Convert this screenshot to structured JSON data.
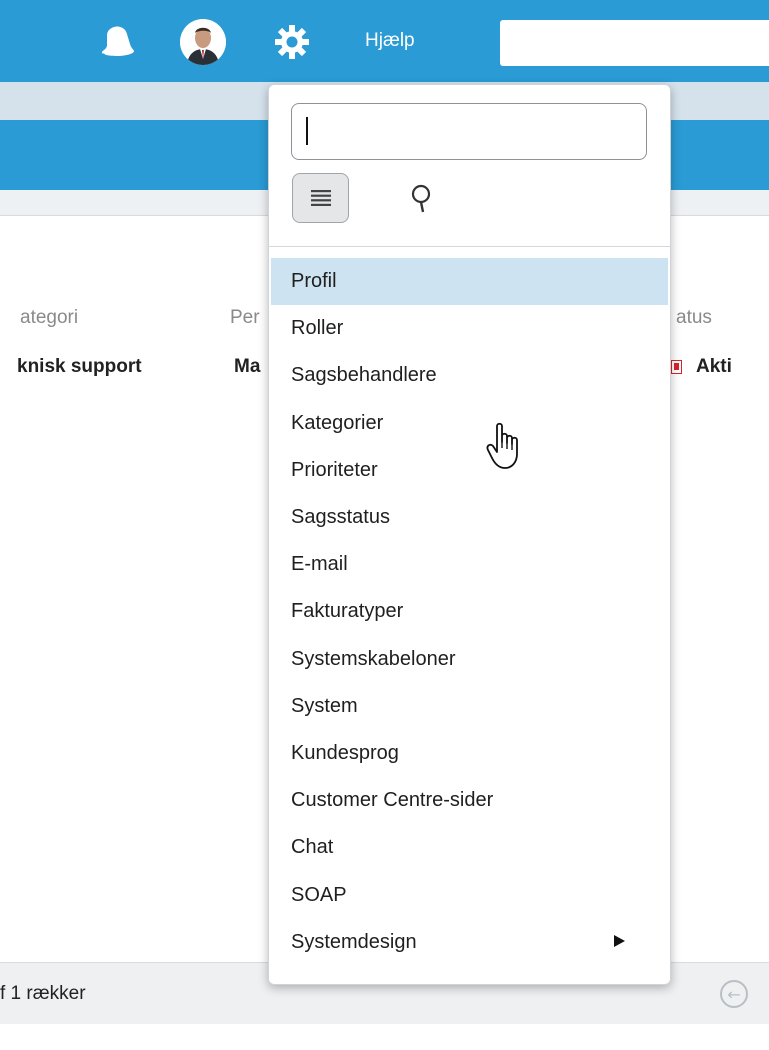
{
  "topbar": {
    "help_label": "Hjælp",
    "search_value": "",
    "icons": [
      "bell-icon",
      "avatar",
      "gear-icon"
    ]
  },
  "table": {
    "headers": [
      "ategori",
      "Per",
      "atus"
    ],
    "row": [
      "knisk support",
      "Ma",
      "Akti"
    ]
  },
  "footer": {
    "text": "f 1 rækker"
  },
  "dropdown": {
    "search_value": "",
    "menu": [
      {
        "label": "Profil",
        "active": true
      },
      {
        "label": "Roller"
      },
      {
        "label": "Sagsbehandlere"
      },
      {
        "label": "Kategorier"
      },
      {
        "label": "Prioriteter"
      },
      {
        "label": "Sagsstatus"
      },
      {
        "label": "E-mail"
      },
      {
        "label": "Fakturatyper"
      },
      {
        "label": "Systemskabeloner"
      },
      {
        "label": "System"
      },
      {
        "label": "Kundesprog"
      },
      {
        "label": "Customer Centre-sider"
      },
      {
        "label": "Chat"
      },
      {
        "label": "SOAP"
      },
      {
        "label": "Systemdesign",
        "has_submenu": true
      }
    ]
  },
  "colors": {
    "brand_blue": "#2a9bd4",
    "active_item": "#cde3f1",
    "status_red": "#d9232d"
  }
}
